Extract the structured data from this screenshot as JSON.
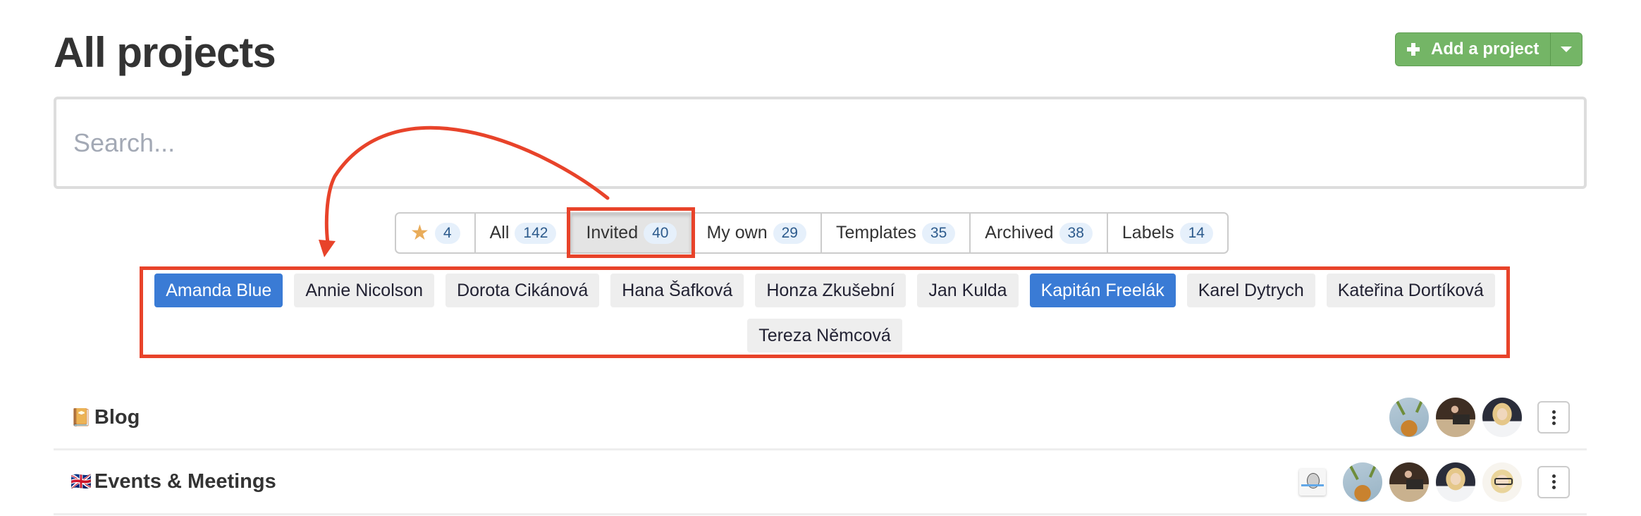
{
  "page": {
    "title": "All projects"
  },
  "add_project": {
    "label": "Add a project",
    "icon": "plus-icon",
    "dropdown_icon": "caret-down-icon",
    "color": "#74b566"
  },
  "search": {
    "placeholder": "Search...",
    "value": ""
  },
  "filter_tabs": [
    {
      "id": "favorites",
      "label": "",
      "icon": "star-icon",
      "count": "4",
      "active": false
    },
    {
      "id": "all",
      "label": "All",
      "count": "142",
      "active": false
    },
    {
      "id": "invited",
      "label": "Invited",
      "count": "40",
      "active": true
    },
    {
      "id": "my-own",
      "label": "My own",
      "count": "29",
      "active": false
    },
    {
      "id": "templates",
      "label": "Templates",
      "count": "35",
      "active": false
    },
    {
      "id": "archived",
      "label": "Archived",
      "count": "38",
      "active": false
    },
    {
      "id": "labels",
      "label": "Labels",
      "count": "14",
      "active": false
    }
  ],
  "people_filter": [
    {
      "name": "Amanda Blue",
      "selected": true
    },
    {
      "name": "Annie Nicolson",
      "selected": false
    },
    {
      "name": "Dorota Cikánová",
      "selected": false
    },
    {
      "name": "Hana Šafková",
      "selected": false
    },
    {
      "name": "Honza Zkušební",
      "selected": false
    },
    {
      "name": "Jan Kulda",
      "selected": false
    },
    {
      "name": "Kapitán Freelák",
      "selected": true
    },
    {
      "name": "Karel Dytrych",
      "selected": false
    },
    {
      "name": "Kateřina Dortíková",
      "selected": false
    },
    {
      "name": "Tereza Němcová",
      "selected": false
    }
  ],
  "projects": [
    {
      "emoji": "📔",
      "name": "Blog",
      "members": [
        "avatar-plant",
        "avatar-laptop-man",
        "avatar-blonde-woman"
      ],
      "more_icon": "kebab-menu-icon"
    },
    {
      "emoji": "🇬🇧",
      "name": "Events & Meetings",
      "members": [
        "avatar-sketch-card",
        "avatar-plant",
        "avatar-laptop-man",
        "avatar-blonde-woman",
        "avatar-woman-glasses"
      ],
      "more_icon": "kebab-menu-icon"
    }
  ],
  "annotations": {
    "color": "#e8432a",
    "highlight_targets": [
      "invited-tab",
      "people-filter"
    ],
    "arrow": "from invited-tab to people-filter"
  }
}
